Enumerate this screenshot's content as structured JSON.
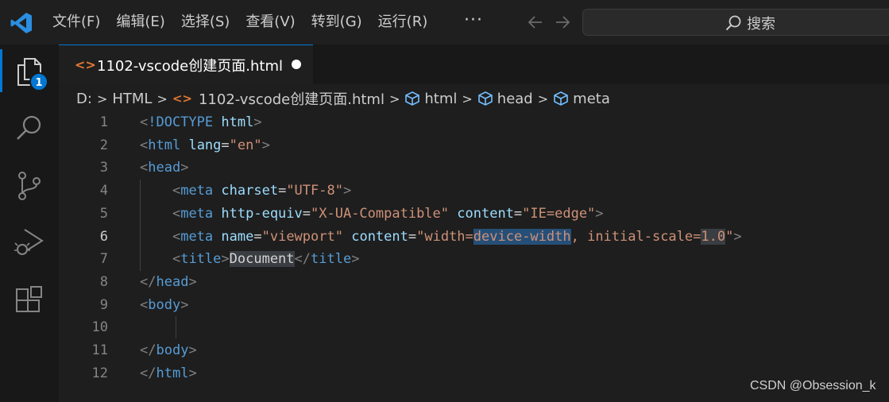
{
  "menu": {
    "items": [
      "文件(F)",
      "编辑(E)",
      "选择(S)",
      "查看(V)",
      "转到(G)",
      "运行(R)"
    ],
    "more": "···"
  },
  "search": {
    "label": "搜索"
  },
  "activity": {
    "explorer_badge": "1"
  },
  "tab": {
    "filename": "1102-vscode创建页面.html",
    "icon": "<>",
    "modified": true
  },
  "breadcrumb": {
    "drive": "D:",
    "folder": "HTML",
    "file": "1102-vscode创建页面.html",
    "html_icon": "<>",
    "sym1": "html",
    "sym2": "head",
    "sym3": "meta"
  },
  "editor": {
    "active_line": 6,
    "line_numbers": [
      "1",
      "2",
      "3",
      "4",
      "5",
      "6",
      "7",
      "8",
      "9",
      "10",
      "11",
      "12"
    ],
    "tokens": {
      "lt": "<",
      "gt": ">",
      "lt_slash": "</",
      "bang_doctype": "!DOCTYPE",
      "html": "html",
      "head": "head",
      "meta": "meta",
      "title": "title",
      "body": "body",
      "lang": "lang",
      "eq": "=",
      "en": "\"en\"",
      "charset": "charset",
      "utf8": "\"UTF-8\"",
      "http_equiv": "http-equiv",
      "xua": "\"X-UA-Compatible\"",
      "content": "content",
      "ie_edge": "\"IE=edge\"",
      "name": "name",
      "viewport": "\"viewport\"",
      "vp_open": "\"width=",
      "vp_device": "device-width",
      "vp_mid": ", initial-scale=",
      "vp_scale": "1.0",
      "vp_close": "\"",
      "document": "Document"
    }
  },
  "watermark": "CSDN @Obsession_k",
  "colors": {
    "accent": "#0078d4",
    "tag": "#569cd6",
    "attr": "#9cdcfe",
    "string": "#ce9178",
    "punct": "#808080"
  }
}
